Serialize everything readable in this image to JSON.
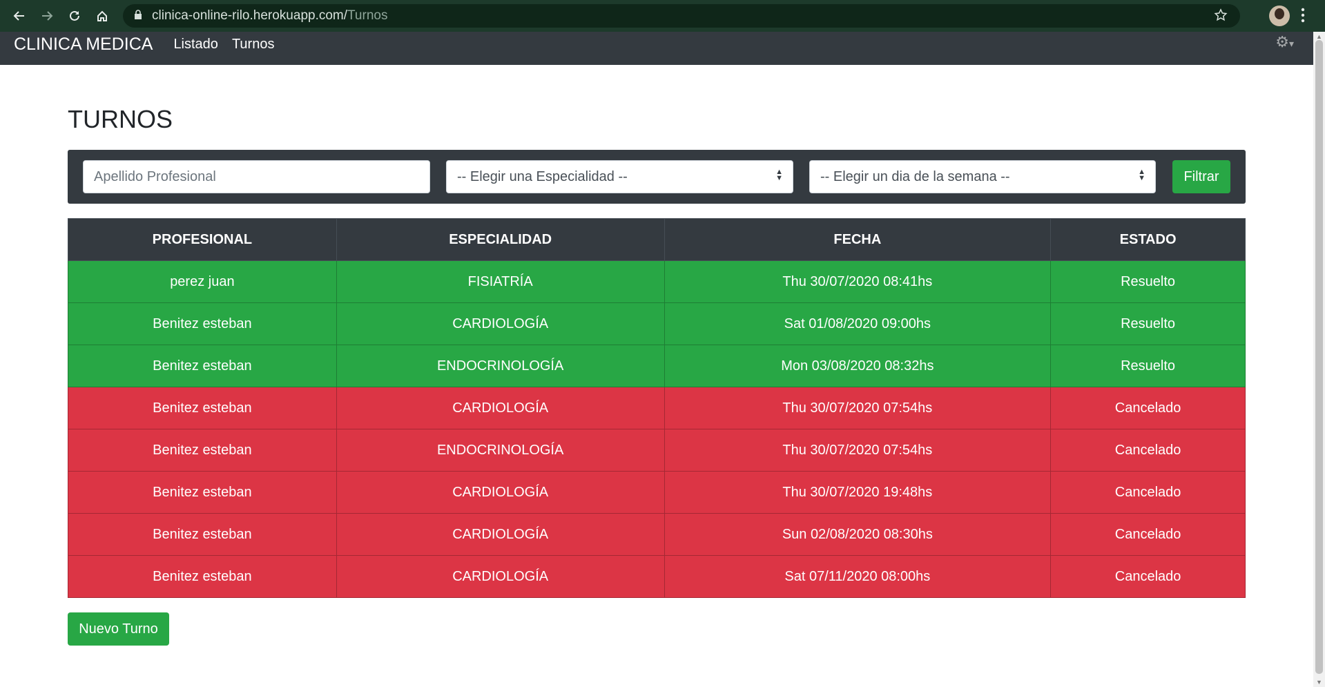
{
  "browser": {
    "url_host": "clinica-online-rilo.herokuapp.com/",
    "url_path": "Turnos"
  },
  "navbar": {
    "brand": "CLINICA MEDICA",
    "links": [
      "Listado",
      "Turnos"
    ]
  },
  "page": {
    "title": "TURNOS"
  },
  "filters": {
    "apellido_placeholder": "Apellido Profesional",
    "especialidad_selected": "-- Elegir una Especialidad --",
    "dia_selected": "-- Elegir un dia de la semana --",
    "filter_button": "Filtrar"
  },
  "table": {
    "headers": [
      "PROFESIONAL",
      "ESPECIALIDAD",
      "FECHA",
      "ESTADO"
    ],
    "rows": [
      {
        "profesional": "perez juan",
        "especialidad": "FISIATRÍA",
        "fecha": "Thu 30/07/2020 08:41hs",
        "estado": "Resuelto"
      },
      {
        "profesional": "Benitez esteban",
        "especialidad": "CARDIOLOGÍA",
        "fecha": "Sat 01/08/2020 09:00hs",
        "estado": "Resuelto"
      },
      {
        "profesional": "Benitez esteban",
        "especialidad": "ENDOCRINOLOGÍA",
        "fecha": "Mon 03/08/2020 08:32hs",
        "estado": "Resuelto"
      },
      {
        "profesional": "Benitez esteban",
        "especialidad": "CARDIOLOGÍA",
        "fecha": "Thu 30/07/2020 07:54hs",
        "estado": "Cancelado"
      },
      {
        "profesional": "Benitez esteban",
        "especialidad": "ENDOCRINOLOGÍA",
        "fecha": "Thu 30/07/2020 07:54hs",
        "estado": "Cancelado"
      },
      {
        "profesional": "Benitez esteban",
        "especialidad": "CARDIOLOGÍA",
        "fecha": "Thu 30/07/2020 19:48hs",
        "estado": "Cancelado"
      },
      {
        "profesional": "Benitez esteban",
        "especialidad": "CARDIOLOGÍA",
        "fecha": "Sun 02/08/2020 08:30hs",
        "estado": "Cancelado"
      },
      {
        "profesional": "Benitez esteban",
        "especialidad": "CARDIOLOGÍA",
        "fecha": "Sat 07/11/2020 08:00hs",
        "estado": "Cancelado"
      }
    ]
  },
  "actions": {
    "new_button": "Nuevo Turno"
  },
  "colors": {
    "navbar": "#343a40",
    "resuelto": "#28a745",
    "cancelado": "#dc3545",
    "button": "#28a745"
  }
}
